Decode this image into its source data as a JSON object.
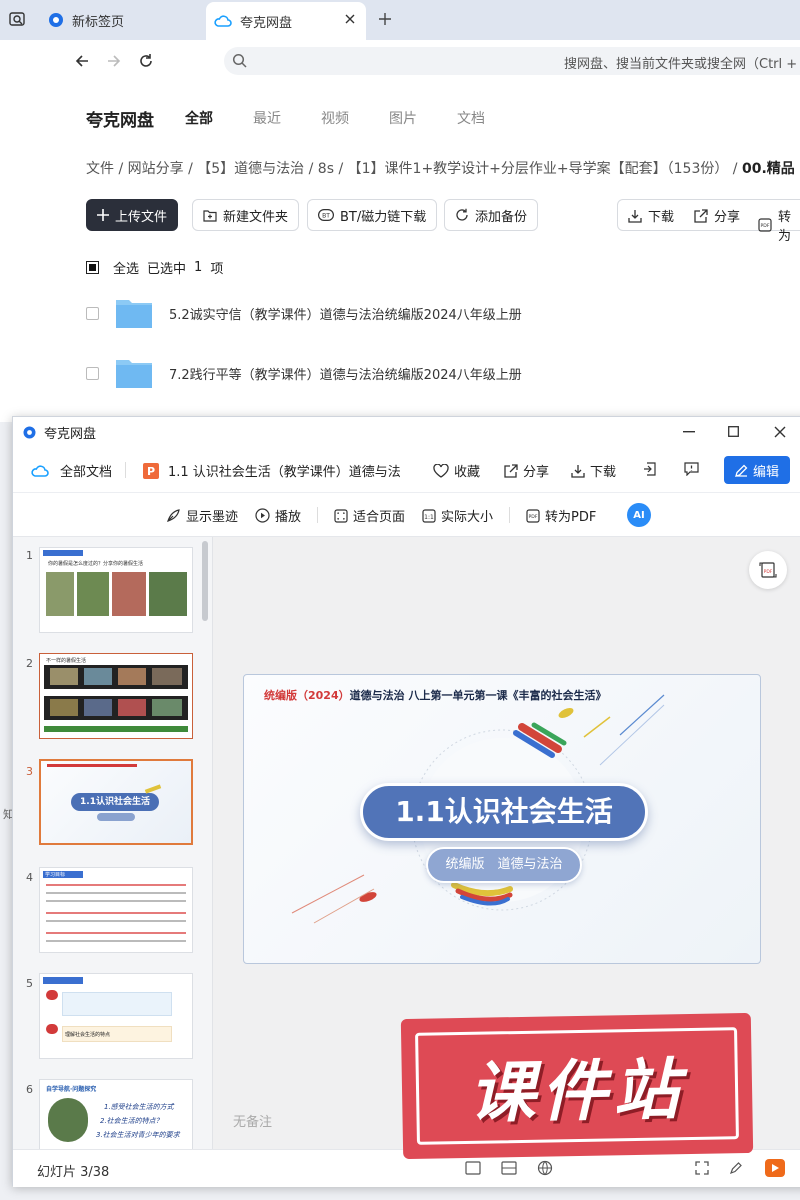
{
  "browser": {
    "tabs": [
      {
        "label": "新标签页"
      },
      {
        "label": "夸克网盘"
      }
    ],
    "address_placeholder": "搜网盘、搜当前文件夹或搜全网（Ctrl + F"
  },
  "drive": {
    "brand": "夸克网盘",
    "nav": [
      "全部",
      "最近",
      "视频",
      "图片",
      "文档"
    ],
    "breadcrumb": [
      "文件",
      "网站分享",
      "【5】道德与法治",
      "8s",
      "【1】课件1+教学设计+分层作业+导学案【配套】（153份）",
      "00.精品"
    ],
    "actions": {
      "upload": "上传文件",
      "new_folder": "新建文件夹",
      "bt": "BT/磁力链下载",
      "backup": "添加备份",
      "download": "下载",
      "share": "分享",
      "to_pdf": "转为"
    },
    "selection": {
      "select_all": "全选",
      "selected_prefix": "已选中",
      "selected_count": "1",
      "selected_suffix": "项"
    },
    "files": [
      {
        "name": "5.2诚实守信（教学课件）道德与法治统编版2024八年级上册"
      },
      {
        "name": "7.2践行平等（教学课件）道德与法治统编版2024八年级上册"
      }
    ]
  },
  "viewer": {
    "window_title": "夸克网盘",
    "all_docs": "全部文档",
    "doc_title": "1.1 认识社会生活（教学课件）道德与法",
    "toolbar": {
      "favorite": "收藏",
      "share": "分享",
      "download": "下载",
      "edit": "编辑"
    },
    "toolbar2": {
      "ink": "显示墨迹",
      "play": "播放",
      "fit": "适合页面",
      "actual": "实际大小",
      "pdf": "转为PDF",
      "ai": "AI"
    },
    "thumbnails": [
      {
        "num": "1",
        "title": "你的暑假是怎么度过的？分享你的暑假生活"
      },
      {
        "num": "2",
        "title": "不一样的暑假生活"
      },
      {
        "num": "3",
        "title": "1.1认识社会生活"
      },
      {
        "num": "4",
        "title": "学习目标"
      },
      {
        "num": "5",
        "title": "理解社会生活的特点"
      },
      {
        "num": "6",
        "title": "自学导航·问题探究",
        "items": [
          "1.感受社会生活的方式",
          "2.社会生活的特点？",
          "3.社会生活对青少年的要求"
        ]
      }
    ],
    "slide": {
      "header_red": "统编版（2024）",
      "header_rest": "道德与法治 八上第一单元第一课《丰富的社会生活》",
      "main_title": "1.1认识社会生活",
      "sub_title": "统编版　道德与法治"
    },
    "notes": "无备注",
    "slide_counter": "幻灯片 3/38",
    "side_char": "知"
  },
  "watermark": "课件站",
  "colors": {
    "accent": "#1f6fe6",
    "edit_button": "#1f6fe6",
    "upload_button": "#2b2f3a",
    "selected_thumb": "#e07a3c",
    "stamp": "#de4a55"
  }
}
